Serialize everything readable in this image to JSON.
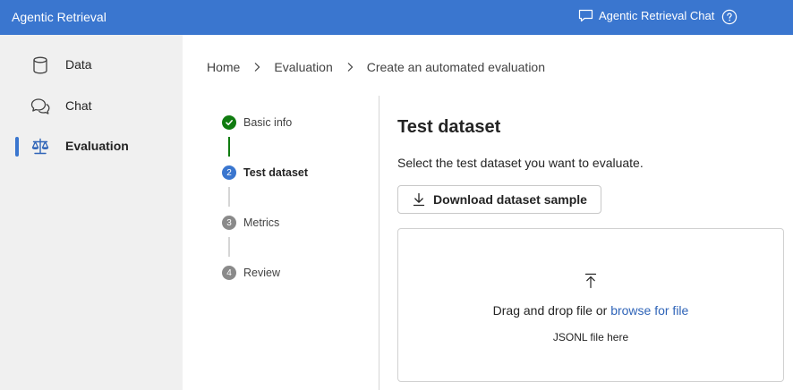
{
  "header": {
    "app_title": "Agentic Retrieval",
    "chat_link_label": "Agentic Retrieval Chat",
    "accent_color": "#3a76cf"
  },
  "sidebar": {
    "items": [
      {
        "label": "Data",
        "icon": "database-icon",
        "active": false
      },
      {
        "label": "Chat",
        "icon": "chat-icon",
        "active": false
      },
      {
        "label": "Evaluation",
        "icon": "scales-icon",
        "active": true
      }
    ]
  },
  "breadcrumb": {
    "items": [
      "Home",
      "Evaluation",
      "Create an automated evaluation"
    ]
  },
  "stepper": {
    "steps": [
      {
        "number": "1",
        "label": "Basic info",
        "state": "done"
      },
      {
        "number": "2",
        "label": "Test dataset",
        "state": "current"
      },
      {
        "number": "3",
        "label": "Metrics",
        "state": "pending"
      },
      {
        "number": "4",
        "label": "Review",
        "state": "pending"
      }
    ],
    "done_color": "#107c10"
  },
  "main": {
    "title": "Test dataset",
    "description": "Select the test dataset you want to evaluate.",
    "download_button_label": "Download dataset sample",
    "dropzone": {
      "text_before_link": "Drag and drop file or ",
      "link_text": "browse for file",
      "hint": "JSONL file here"
    }
  }
}
